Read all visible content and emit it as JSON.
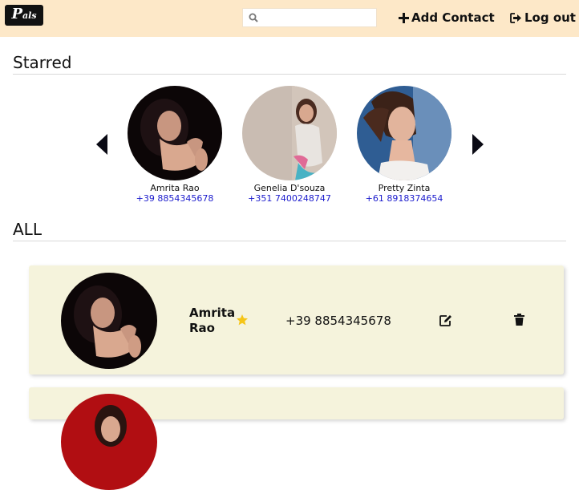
{
  "header": {
    "logo_big": "P",
    "logo_small": "als",
    "search_placeholder": "",
    "add_contact_label": "Add Contact",
    "logout_label": "Log out"
  },
  "sections": {
    "starred": "Starred",
    "all": "ALL"
  },
  "starred": [
    {
      "name": "Amrita Rao",
      "phone": "+39 8854345678"
    },
    {
      "name": "Genelia D'souza",
      "phone": "+351 7400248747"
    },
    {
      "name": "Pretty Zinta",
      "phone": "+61 8918374654"
    }
  ],
  "contacts": [
    {
      "name": "Amrita Rao",
      "phone": "+39 8854345678",
      "starred": true
    }
  ],
  "colors": {
    "header_bg": "#fde8c8",
    "row_bg": "#f5f3dc",
    "phone_link": "#1a1acc",
    "star": "#f5c518"
  }
}
